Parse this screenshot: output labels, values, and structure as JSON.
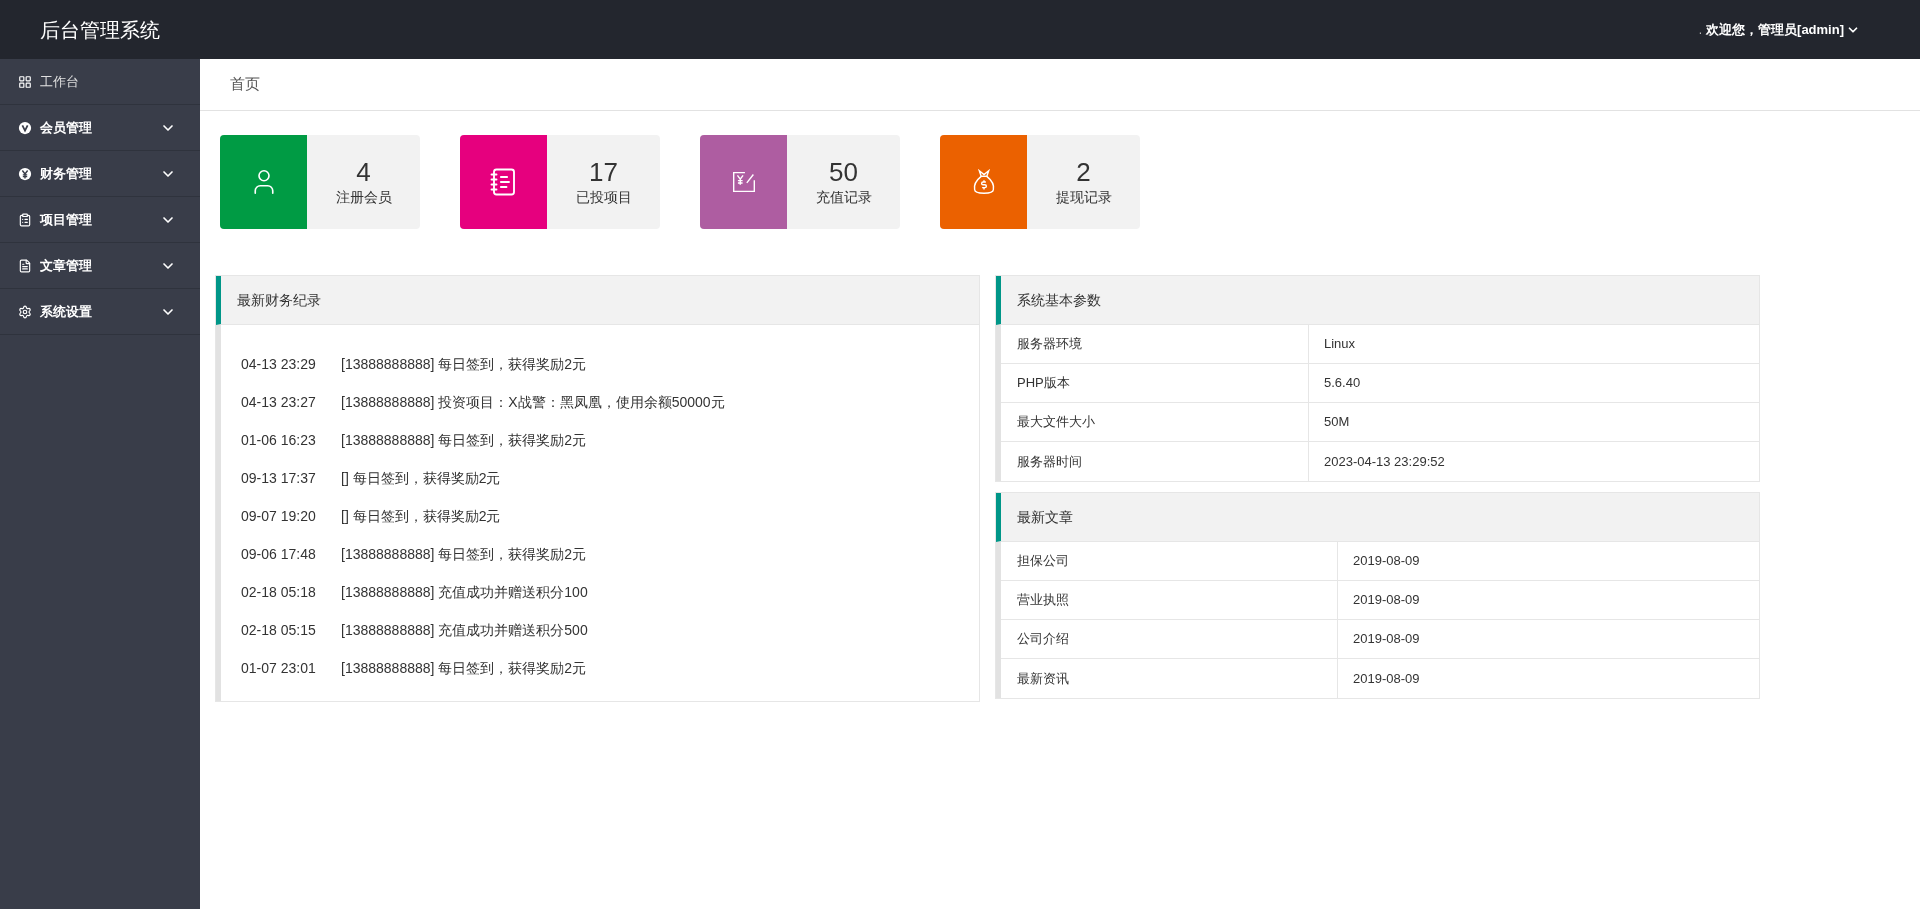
{
  "header": {
    "title": "后台管理系统",
    "dot": ".",
    "user": "欢迎您，管理员[admin]"
  },
  "sidebar": {
    "items": [
      {
        "label": "工作台",
        "kind": "link"
      },
      {
        "label": "会员管理",
        "kind": "menu"
      },
      {
        "label": "财务管理",
        "kind": "menu"
      },
      {
        "label": "项目管理",
        "kind": "menu"
      },
      {
        "label": "文章管理",
        "kind": "menu"
      },
      {
        "label": "系统设置",
        "kind": "menu"
      }
    ]
  },
  "breadcrumb": "首页",
  "stats": [
    {
      "value": "4",
      "label": "注册会员",
      "color": "#009b44"
    },
    {
      "value": "17",
      "label": "已投项目",
      "color": "#e6007e"
    },
    {
      "value": "50",
      "label": "充值记录",
      "color": "#ae5da1"
    },
    {
      "value": "2",
      "label": "提现记录",
      "color": "#eb6100"
    }
  ],
  "finance": {
    "title": "最新财务纪录",
    "records": [
      {
        "time": "04-13 23:29",
        "text": "[13888888888] 每日签到，获得奖励2元"
      },
      {
        "time": "04-13 23:27",
        "text": "[13888888888] 投资项目：X战警：黑凤凰，使用余额50000元"
      },
      {
        "time": "01-06 16:23",
        "text": "[13888888888] 每日签到，获得奖励2元"
      },
      {
        "time": "09-13 17:37",
        "text": "[] 每日签到，获得奖励2元"
      },
      {
        "time": "09-07 19:20",
        "text": "[] 每日签到，获得奖励2元"
      },
      {
        "time": "09-06 17:48",
        "text": "[13888888888] 每日签到，获得奖励2元"
      },
      {
        "time": "02-18 05:18",
        "text": "[13888888888] 充值成功并赠送积分100"
      },
      {
        "time": "02-18 05:15",
        "text": "[13888888888] 充值成功并赠送积分500"
      },
      {
        "time": "01-07 23:01",
        "text": "[13888888888] 每日签到，获得奖励2元"
      }
    ]
  },
  "system": {
    "title": "系统基本参数",
    "rows": [
      {
        "name": "服务器环境",
        "value": "Linux"
      },
      {
        "name": "PHP版本",
        "value": "5.6.40"
      },
      {
        "name": "最大文件大小",
        "value": "50M"
      },
      {
        "name": "服务器时间",
        "value": "2023-04-13 23:29:52"
      }
    ]
  },
  "articles": {
    "title": "最新文章",
    "rows": [
      {
        "name": "担保公司",
        "date": "2019-08-09"
      },
      {
        "name": "营业执照",
        "date": "2019-08-09"
      },
      {
        "name": "公司介绍",
        "date": "2019-08-09"
      },
      {
        "name": "最新资讯",
        "date": "2019-08-09"
      }
    ]
  }
}
